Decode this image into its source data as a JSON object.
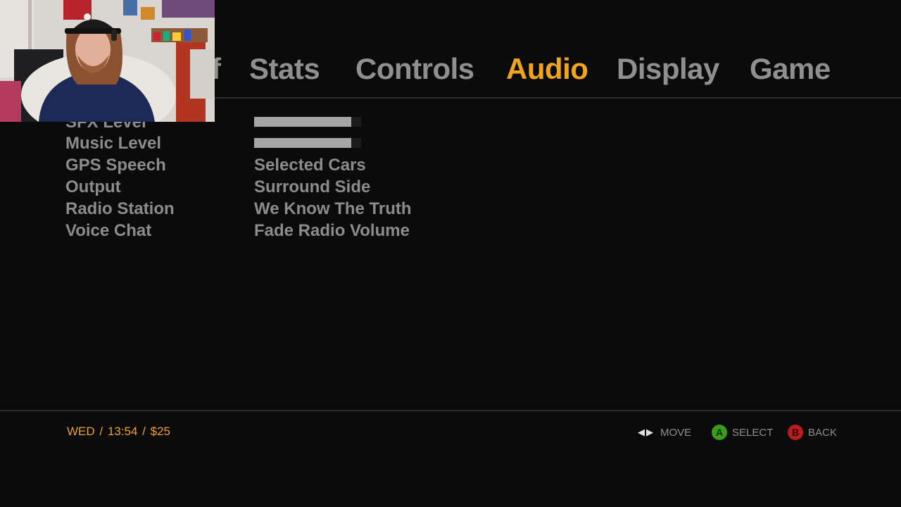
{
  "webcam": {
    "description_icon": "webcam-person-icon"
  },
  "tabs": [
    {
      "label": "f",
      "active": false
    },
    {
      "label": "Stats",
      "active": false
    },
    {
      "label": "Controls",
      "active": false
    },
    {
      "label": "Audio",
      "active": true
    },
    {
      "label": "Display",
      "active": false
    },
    {
      "label": "Game",
      "active": false
    }
  ],
  "options": [
    {
      "label": "SFX Level",
      "type": "bar",
      "level": 0.91
    },
    {
      "label": "Music Level",
      "type": "bar",
      "level": 0.91
    },
    {
      "label": "GPS Speech",
      "type": "value",
      "value": "Selected Cars"
    },
    {
      "label": "Output",
      "type": "value",
      "value": "Surround Side"
    },
    {
      "label": "Radio Station",
      "type": "value",
      "value": "We Know The Truth"
    },
    {
      "label": "Voice Chat",
      "type": "value",
      "value": "Fade Radio Volume"
    }
  ],
  "status": {
    "day": "WED",
    "time": "13:54",
    "money": "$25",
    "separator": "/"
  },
  "hints": {
    "move": {
      "label": "MOVE",
      "icon": "left-right-arrows-icon"
    },
    "select": {
      "label": "SELECT",
      "button": "A"
    },
    "back": {
      "label": "BACK",
      "button": "B"
    }
  },
  "colors": {
    "active_tab": "#f0a31c",
    "inactive_text": "#8c8c8c",
    "status_text": "#e9a032",
    "button_a": "#3b9b1f",
    "button_b": "#b81d1d"
  }
}
